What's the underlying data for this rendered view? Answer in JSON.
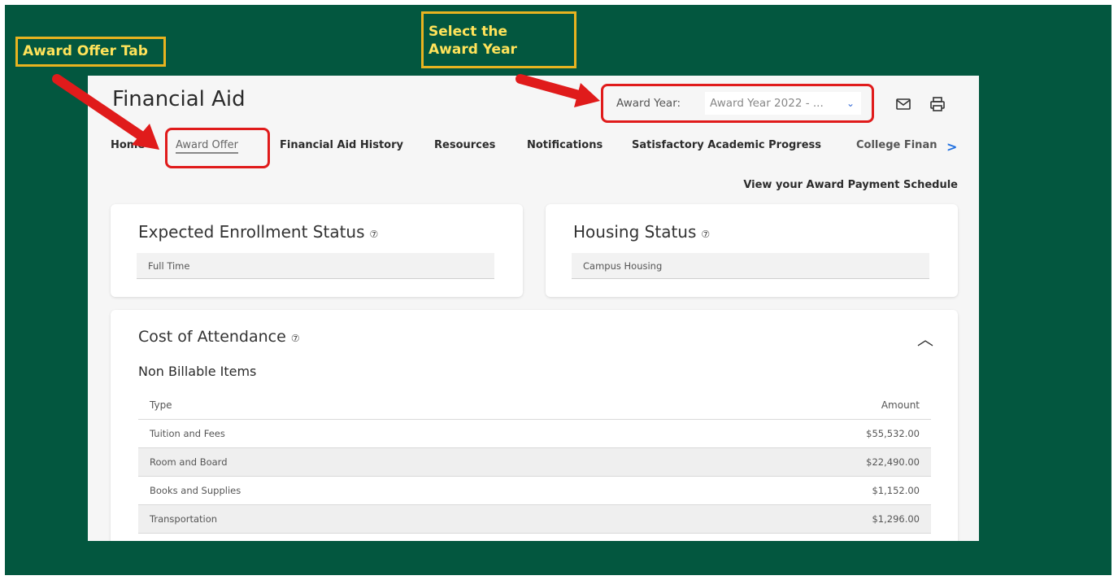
{
  "annotations": {
    "award_offer_tab": "Award Offer Tab",
    "select_award_year_line1": "Select the",
    "select_award_year_line2": "Award Year"
  },
  "page": {
    "title": "Financial Aid",
    "award_year_label": "Award Year:",
    "award_year_value": "Award Year 2022 - ...",
    "icons": [
      "mail-icon",
      "print-icon"
    ]
  },
  "nav": {
    "items": [
      {
        "label": "Home",
        "active": false
      },
      {
        "label": "Award Offer",
        "active": true
      },
      {
        "label": "Financial Aid History",
        "active": false
      },
      {
        "label": "Resources",
        "active": false
      },
      {
        "label": "Notifications",
        "active": false
      },
      {
        "label": "Satisfactory Academic Progress",
        "active": false
      },
      {
        "label": "College Finan",
        "active": false
      }
    ],
    "next_icon": "chevron-right-icon"
  },
  "payment_schedule_link": "View your Award Payment Schedule",
  "enrollment": {
    "title": "Expected Enrollment Status",
    "help_glyph": "⑦",
    "value": "Full Time"
  },
  "housing": {
    "title": "Housing Status",
    "help_glyph": "⑦",
    "value": "Campus Housing"
  },
  "cost": {
    "title": "Cost of Attendance",
    "help_glyph": "⑦",
    "section": "Non Billable Items",
    "columns": [
      "Type",
      "Amount"
    ],
    "rows": [
      {
        "type": "Tuition and Fees",
        "amount": "$55,532.00"
      },
      {
        "type": "Room and Board",
        "amount": "$22,490.00"
      },
      {
        "type": "Books and Supplies",
        "amount": "$1,152.00"
      },
      {
        "type": "Transportation",
        "amount": "$1,296.00"
      }
    ]
  },
  "colors": {
    "background_green": "#03573f",
    "callout_border": "#e8b320",
    "callout_text": "#ffe35a",
    "highlight_red": "#e01b1b",
    "link_blue": "#1f6fe0"
  }
}
